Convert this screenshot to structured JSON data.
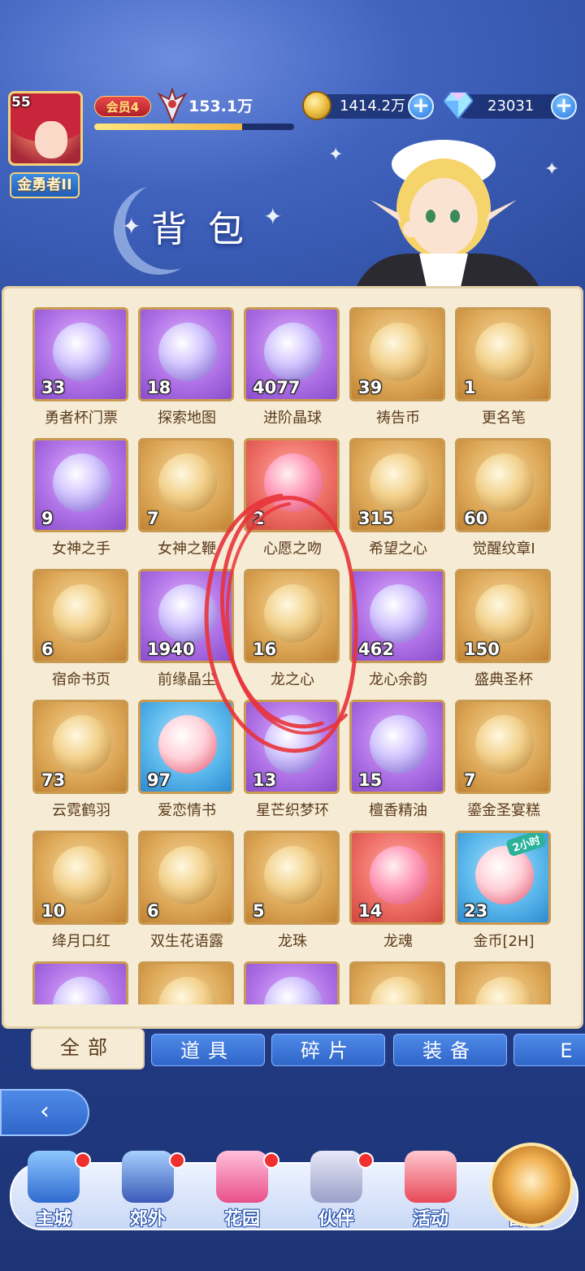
{
  "player": {
    "level": "55",
    "rank_title": "金勇者II",
    "vip_label": "会员4",
    "power": "153.1万",
    "exp_progress": 0.74
  },
  "resources": {
    "gold": "1414.2万",
    "gems": "23031",
    "plus_symbol": "+"
  },
  "page": {
    "title": "背包"
  },
  "items": [
    {
      "name": "勇者杯门票",
      "count": "33",
      "rarity": "purple"
    },
    {
      "name": "探索地图",
      "count": "18",
      "rarity": "purple"
    },
    {
      "name": "进阶晶球",
      "count": "4077",
      "rarity": "purple"
    },
    {
      "name": "祷告币",
      "count": "39",
      "rarity": "gold"
    },
    {
      "name": "更名笔",
      "count": "1",
      "rarity": "gold"
    },
    {
      "name": "女神之手",
      "count": "9",
      "rarity": "purple"
    },
    {
      "name": "女神之鞭",
      "count": "7",
      "rarity": "gold"
    },
    {
      "name": "心愿之吻",
      "count": "2",
      "rarity": "red"
    },
    {
      "name": "希望之心",
      "count": "315",
      "rarity": "gold"
    },
    {
      "name": "觉醒纹章I",
      "count": "60",
      "rarity": "gold"
    },
    {
      "name": "宿命书页",
      "count": "6",
      "rarity": "gold"
    },
    {
      "name": "前缘晶尘",
      "count": "1940",
      "rarity": "purple"
    },
    {
      "name": "龙之心",
      "count": "16",
      "rarity": "gold"
    },
    {
      "name": "龙心余韵",
      "count": "462",
      "rarity": "purple"
    },
    {
      "name": "盛典圣杯",
      "count": "150",
      "rarity": "gold"
    },
    {
      "name": "云霓鹤羽",
      "count": "73",
      "rarity": "gold"
    },
    {
      "name": "爱恋情书",
      "count": "97",
      "rarity": "blue"
    },
    {
      "name": "星芒织梦环",
      "count": "13",
      "rarity": "purple"
    },
    {
      "name": "檀香精油",
      "count": "15",
      "rarity": "purple"
    },
    {
      "name": "鎏金圣宴糕",
      "count": "7",
      "rarity": "gold"
    },
    {
      "name": "绛月口红",
      "count": "10",
      "rarity": "gold"
    },
    {
      "name": "双生花语露",
      "count": "6",
      "rarity": "gold"
    },
    {
      "name": "龙珠",
      "count": "5",
      "rarity": "gold"
    },
    {
      "name": "龙魂",
      "count": "14",
      "rarity": "red"
    },
    {
      "name": "金币[2H]",
      "count": "23",
      "rarity": "blue",
      "tag": "2小时"
    },
    {
      "name": "",
      "count": "",
      "rarity": "purple"
    },
    {
      "name": "",
      "count": "",
      "rarity": "gold"
    },
    {
      "name": "",
      "count": "",
      "rarity": "purple"
    },
    {
      "name": "",
      "count": "",
      "rarity": "gold"
    },
    {
      "name": "",
      "count": "",
      "rarity": "gold"
    }
  ],
  "tabs": [
    "全部",
    "道具",
    "碎片",
    "装备",
    "E"
  ],
  "back_symbol": "‹",
  "nav": [
    {
      "label": "主城",
      "icon": "castle-icon",
      "dot": true
    },
    {
      "label": "郊外",
      "icon": "portal-icon",
      "dot": true
    },
    {
      "label": "花园",
      "icon": "heart-icon",
      "dot": true
    },
    {
      "label": "伙伴",
      "icon": "companion-icon",
      "dot": true
    },
    {
      "label": "活动",
      "icon": "gift-icon",
      "dot": false
    },
    {
      "label": "冒险",
      "icon": "adventure-icon",
      "dot": false
    }
  ],
  "colors": {
    "accent": "#2f66c8",
    "panel": "#f6ecd6",
    "annotation": "#e8333a"
  }
}
